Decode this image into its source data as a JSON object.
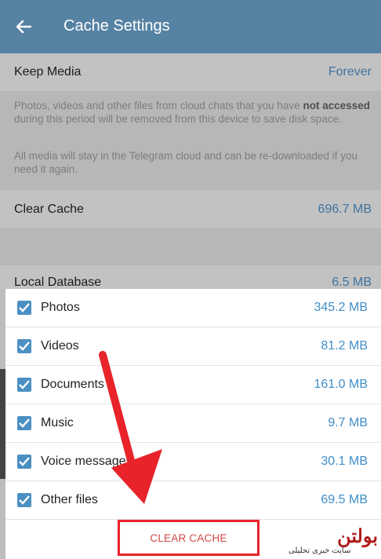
{
  "header": {
    "title": "Cache Settings",
    "back_icon": "arrow-left-icon"
  },
  "settings": {
    "keep_media": {
      "label": "Keep Media",
      "value": "Forever"
    },
    "info": {
      "p1_before": "Photos, videos and other files from cloud chats that you have ",
      "p1_bold": "not accessed",
      "p1_after": " during this period will be removed from this device to save disk space.",
      "p2": "All media will stay in the Telegram cloud and can be re-downloaded if you need it again."
    },
    "clear_cache": {
      "label": "Clear Cache",
      "value": "696.7 MB"
    },
    "local_database": {
      "label": "Local Database",
      "value": "6.5 MB"
    }
  },
  "sheet": {
    "items": [
      {
        "label": "Photos",
        "size": "345.2 MB",
        "checked": true
      },
      {
        "label": "Videos",
        "size": "81.2 MB",
        "checked": true
      },
      {
        "label": "Documents",
        "size": "161.0 MB",
        "checked": true
      },
      {
        "label": "Music",
        "size": "9.7 MB",
        "checked": true
      },
      {
        "label": "Voice messages",
        "size": "30.1 MB",
        "checked": true
      },
      {
        "label": "Other files",
        "size": "69.5 MB",
        "checked": true
      }
    ],
    "button_label": "CLEAR CACHE"
  },
  "watermark": {
    "logo": "بولتن",
    "subtitle": "سایت خبری تحلیلی"
  },
  "colors": {
    "header": "#5682a3",
    "accent": "#3f8ec8",
    "checkbox": "#4a90c2",
    "annotation": "#e8232a"
  }
}
